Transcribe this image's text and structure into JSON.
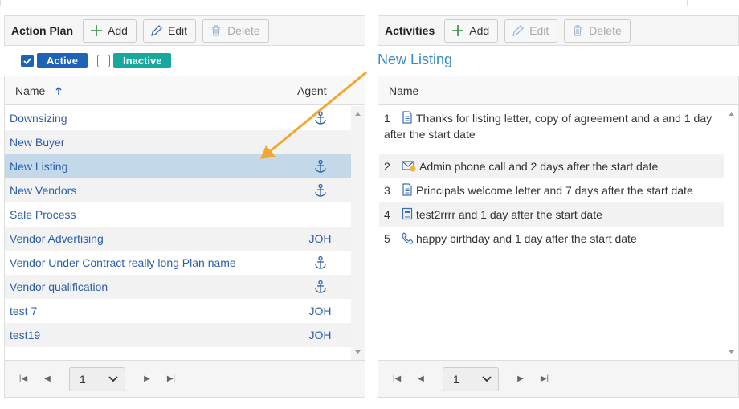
{
  "left": {
    "title": "Action Plan",
    "add": "Add",
    "edit": "Edit",
    "delete": "Delete",
    "filter_active": "Active",
    "filter_inactive": "Inactive",
    "col_name": "Name",
    "col_agent": "Agent",
    "rows": [
      {
        "name": "Downsizing",
        "agent": ""
      },
      {
        "name": "New Buyer",
        "agent": ""
      },
      {
        "name": "New Listing",
        "agent": ""
      },
      {
        "name": "New Vendors",
        "agent": ""
      },
      {
        "name": "Sale Process",
        "agent": ""
      },
      {
        "name": "Vendor Advertising",
        "agent": "JOH"
      },
      {
        "name": "Vendor Under Contract really long Plan name",
        "agent": ""
      },
      {
        "name": "Vendor qualification",
        "agent": ""
      },
      {
        "name": "test 7",
        "agent": "JOH"
      },
      {
        "name": "test19",
        "agent": "JOH"
      }
    ],
    "page": "1"
  },
  "right": {
    "title": "Activities",
    "add": "Add",
    "edit": "Edit",
    "delete": "Delete",
    "selected_plan": "New Listing",
    "col_name": "Name",
    "rows": [
      {
        "num": "1",
        "icon": "document-icon",
        "text": "Thanks for listing letter, copy of agreement and a and 1 day after the start date"
      },
      {
        "num": "2",
        "icon": "mail-alert-icon",
        "text": "Admin phone call and 2 days after the start date"
      },
      {
        "num": "3",
        "icon": "document-icon",
        "text": "Principals welcome letter and 7 days after the start date"
      },
      {
        "num": "4",
        "icon": "newsletter-icon",
        "text": "test2rrrr and 1 day after the start date"
      },
      {
        "num": "5",
        "icon": "phone-icon",
        "text": "happy birthday and 1 day after the start date"
      }
    ],
    "page": "1"
  },
  "colors": {
    "link": "#2c5fa7",
    "active_badge": "#1e63b5",
    "inactive_badge": "#1aa79e",
    "selected_row": "#c3d9ea",
    "heading": "#3a89c6",
    "arrow": "#f0a830"
  }
}
